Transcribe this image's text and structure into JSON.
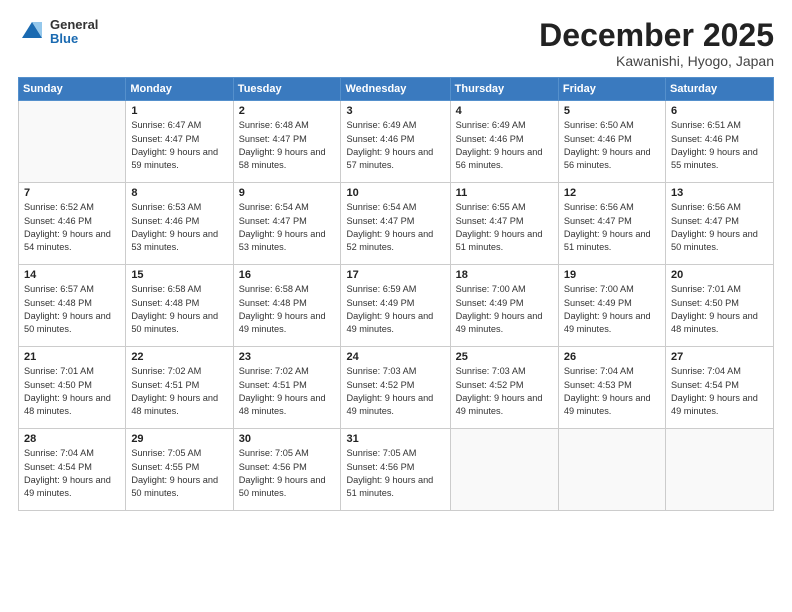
{
  "header": {
    "logo": {
      "general": "General",
      "blue": "Blue"
    },
    "title": "December 2025",
    "location": "Kawanishi, Hyogo, Japan"
  },
  "days_of_week": [
    "Sunday",
    "Monday",
    "Tuesday",
    "Wednesday",
    "Thursday",
    "Friday",
    "Saturday"
  ],
  "weeks": [
    [
      {
        "day": "",
        "sunrise": "",
        "sunset": "",
        "daylight": ""
      },
      {
        "day": "1",
        "sunrise": "Sunrise: 6:47 AM",
        "sunset": "Sunset: 4:47 PM",
        "daylight": "Daylight: 9 hours and 59 minutes."
      },
      {
        "day": "2",
        "sunrise": "Sunrise: 6:48 AM",
        "sunset": "Sunset: 4:47 PM",
        "daylight": "Daylight: 9 hours and 58 minutes."
      },
      {
        "day": "3",
        "sunrise": "Sunrise: 6:49 AM",
        "sunset": "Sunset: 4:46 PM",
        "daylight": "Daylight: 9 hours and 57 minutes."
      },
      {
        "day": "4",
        "sunrise": "Sunrise: 6:49 AM",
        "sunset": "Sunset: 4:46 PM",
        "daylight": "Daylight: 9 hours and 56 minutes."
      },
      {
        "day": "5",
        "sunrise": "Sunrise: 6:50 AM",
        "sunset": "Sunset: 4:46 PM",
        "daylight": "Daylight: 9 hours and 56 minutes."
      },
      {
        "day": "6",
        "sunrise": "Sunrise: 6:51 AM",
        "sunset": "Sunset: 4:46 PM",
        "daylight": "Daylight: 9 hours and 55 minutes."
      }
    ],
    [
      {
        "day": "7",
        "sunrise": "Sunrise: 6:52 AM",
        "sunset": "Sunset: 4:46 PM",
        "daylight": "Daylight: 9 hours and 54 minutes."
      },
      {
        "day": "8",
        "sunrise": "Sunrise: 6:53 AM",
        "sunset": "Sunset: 4:46 PM",
        "daylight": "Daylight: 9 hours and 53 minutes."
      },
      {
        "day": "9",
        "sunrise": "Sunrise: 6:54 AM",
        "sunset": "Sunset: 4:47 PM",
        "daylight": "Daylight: 9 hours and 53 minutes."
      },
      {
        "day": "10",
        "sunrise": "Sunrise: 6:54 AM",
        "sunset": "Sunset: 4:47 PM",
        "daylight": "Daylight: 9 hours and 52 minutes."
      },
      {
        "day": "11",
        "sunrise": "Sunrise: 6:55 AM",
        "sunset": "Sunset: 4:47 PM",
        "daylight": "Daylight: 9 hours and 51 minutes."
      },
      {
        "day": "12",
        "sunrise": "Sunrise: 6:56 AM",
        "sunset": "Sunset: 4:47 PM",
        "daylight": "Daylight: 9 hours and 51 minutes."
      },
      {
        "day": "13",
        "sunrise": "Sunrise: 6:56 AM",
        "sunset": "Sunset: 4:47 PM",
        "daylight": "Daylight: 9 hours and 50 minutes."
      }
    ],
    [
      {
        "day": "14",
        "sunrise": "Sunrise: 6:57 AM",
        "sunset": "Sunset: 4:48 PM",
        "daylight": "Daylight: 9 hours and 50 minutes."
      },
      {
        "day": "15",
        "sunrise": "Sunrise: 6:58 AM",
        "sunset": "Sunset: 4:48 PM",
        "daylight": "Daylight: 9 hours and 50 minutes."
      },
      {
        "day": "16",
        "sunrise": "Sunrise: 6:58 AM",
        "sunset": "Sunset: 4:48 PM",
        "daylight": "Daylight: 9 hours and 49 minutes."
      },
      {
        "day": "17",
        "sunrise": "Sunrise: 6:59 AM",
        "sunset": "Sunset: 4:49 PM",
        "daylight": "Daylight: 9 hours and 49 minutes."
      },
      {
        "day": "18",
        "sunrise": "Sunrise: 7:00 AM",
        "sunset": "Sunset: 4:49 PM",
        "daylight": "Daylight: 9 hours and 49 minutes."
      },
      {
        "day": "19",
        "sunrise": "Sunrise: 7:00 AM",
        "sunset": "Sunset: 4:49 PM",
        "daylight": "Daylight: 9 hours and 49 minutes."
      },
      {
        "day": "20",
        "sunrise": "Sunrise: 7:01 AM",
        "sunset": "Sunset: 4:50 PM",
        "daylight": "Daylight: 9 hours and 48 minutes."
      }
    ],
    [
      {
        "day": "21",
        "sunrise": "Sunrise: 7:01 AM",
        "sunset": "Sunset: 4:50 PM",
        "daylight": "Daylight: 9 hours and 48 minutes."
      },
      {
        "day": "22",
        "sunrise": "Sunrise: 7:02 AM",
        "sunset": "Sunset: 4:51 PM",
        "daylight": "Daylight: 9 hours and 48 minutes."
      },
      {
        "day": "23",
        "sunrise": "Sunrise: 7:02 AM",
        "sunset": "Sunset: 4:51 PM",
        "daylight": "Daylight: 9 hours and 48 minutes."
      },
      {
        "day": "24",
        "sunrise": "Sunrise: 7:03 AM",
        "sunset": "Sunset: 4:52 PM",
        "daylight": "Daylight: 9 hours and 49 minutes."
      },
      {
        "day": "25",
        "sunrise": "Sunrise: 7:03 AM",
        "sunset": "Sunset: 4:52 PM",
        "daylight": "Daylight: 9 hours and 49 minutes."
      },
      {
        "day": "26",
        "sunrise": "Sunrise: 7:04 AM",
        "sunset": "Sunset: 4:53 PM",
        "daylight": "Daylight: 9 hours and 49 minutes."
      },
      {
        "day": "27",
        "sunrise": "Sunrise: 7:04 AM",
        "sunset": "Sunset: 4:54 PM",
        "daylight": "Daylight: 9 hours and 49 minutes."
      }
    ],
    [
      {
        "day": "28",
        "sunrise": "Sunrise: 7:04 AM",
        "sunset": "Sunset: 4:54 PM",
        "daylight": "Daylight: 9 hours and 49 minutes."
      },
      {
        "day": "29",
        "sunrise": "Sunrise: 7:05 AM",
        "sunset": "Sunset: 4:55 PM",
        "daylight": "Daylight: 9 hours and 50 minutes."
      },
      {
        "day": "30",
        "sunrise": "Sunrise: 7:05 AM",
        "sunset": "Sunset: 4:56 PM",
        "daylight": "Daylight: 9 hours and 50 minutes."
      },
      {
        "day": "31",
        "sunrise": "Sunrise: 7:05 AM",
        "sunset": "Sunset: 4:56 PM",
        "daylight": "Daylight: 9 hours and 51 minutes."
      },
      {
        "day": "",
        "sunrise": "",
        "sunset": "",
        "daylight": ""
      },
      {
        "day": "",
        "sunrise": "",
        "sunset": "",
        "daylight": ""
      },
      {
        "day": "",
        "sunrise": "",
        "sunset": "",
        "daylight": ""
      }
    ]
  ]
}
